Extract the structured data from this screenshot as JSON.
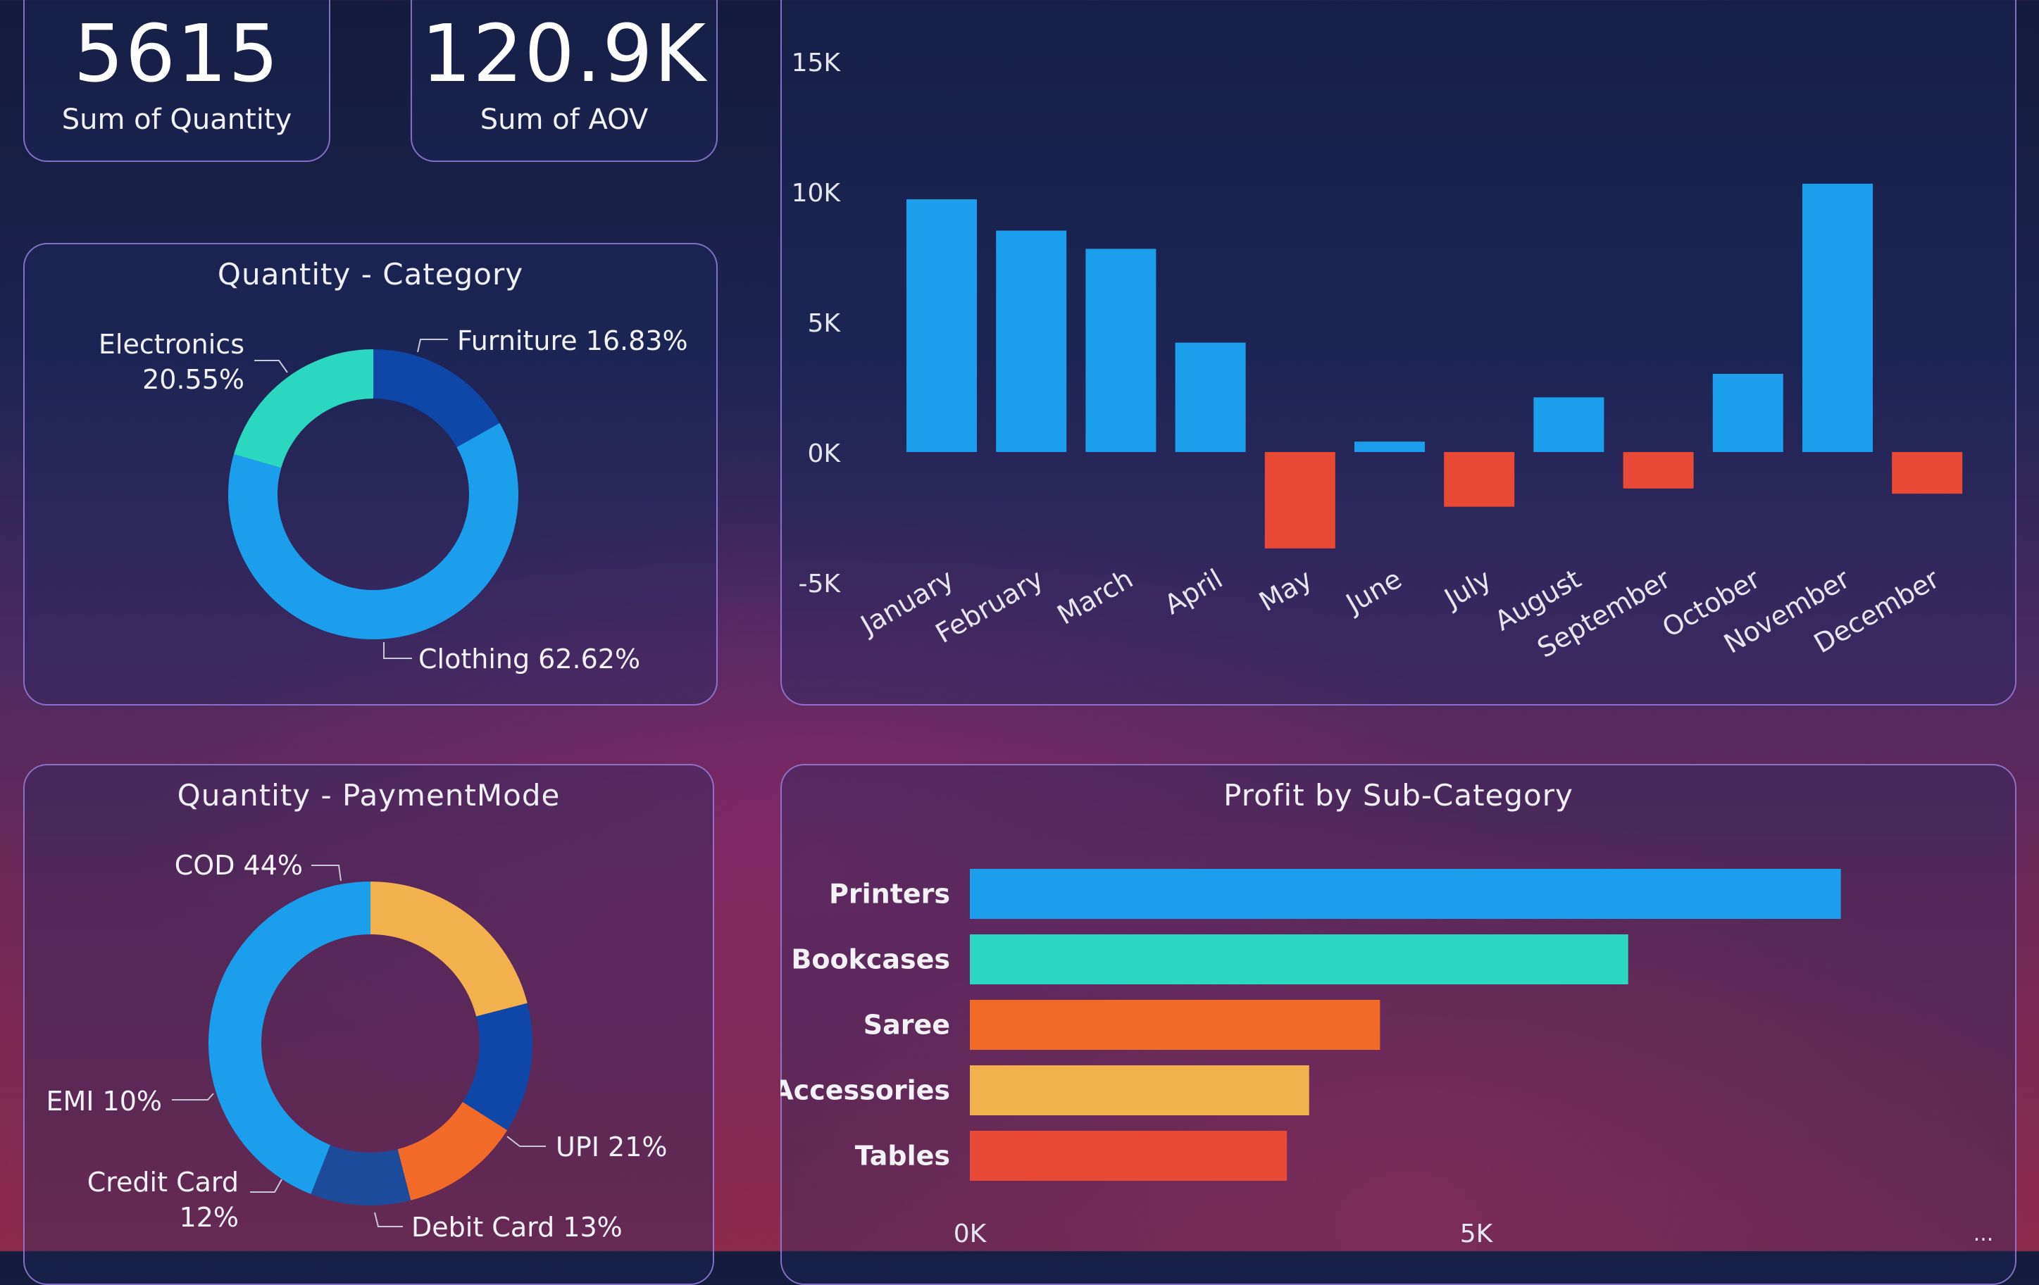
{
  "kpis": [
    {
      "value": "5615",
      "label": "Sum of Quantity"
    },
    {
      "value": "120.9K",
      "label": "Sum of AOV"
    }
  ],
  "category_chart": {
    "title": "Quantity - Category"
  },
  "payment_chart": {
    "title": "Quantity - PaymentMode"
  },
  "subcategory_chart": {
    "title": "Profit by Sub-Category",
    "overflow_label": "..."
  },
  "colors": {
    "blue": "#1b9fec",
    "dark_blue": "#0e47a7",
    "teal": "#2bd8bf",
    "orange": "#f26a27",
    "yellow": "#f2b14c",
    "red": "#e84a35",
    "steel_blue": "#1d4b9c"
  },
  "chart_data": [
    {
      "type": "bar",
      "categories": [
        "January",
        "February",
        "March",
        "April",
        "May",
        "June",
        "July",
        "August",
        "September",
        "October",
        "November",
        "December"
      ],
      "values": [
        9700,
        8500,
        7800,
        4200,
        -3700,
        400,
        -2100,
        2100,
        -1400,
        3000,
        10300,
        -1600
      ],
      "ylim": [
        -5000,
        15000
      ],
      "yticks": [
        "15K",
        "10K",
        "5K",
        "0K",
        "-5K"
      ],
      "colors": {
        "positive": "#1b9fec",
        "negative": "#e84a35"
      }
    },
    {
      "type": "pie",
      "title": "Quantity - Category",
      "slices": [
        {
          "label": "Furniture 16.83%",
          "value": 16.83,
          "color": "#0e47a7"
        },
        {
          "label": "Clothing 62.62%",
          "value": 62.62,
          "color": "#1b9fec"
        },
        {
          "label": "Electronics 20.55%",
          "lines": [
            "Electronics",
            "20.55%"
          ],
          "value": 20.55,
          "color": "#2bd8bf"
        }
      ]
    },
    {
      "type": "pie",
      "title": "Quantity - PaymentMode",
      "slices": [
        {
          "label": "UPI 21%",
          "value": 21,
          "color": "#f2b14c"
        },
        {
          "label": "Debit Card 13%",
          "value": 13,
          "color": "#0e47a7"
        },
        {
          "label": "Credit Card 12%",
          "lines": [
            "Credit Card",
            "12%"
          ],
          "value": 12,
          "color": "#f26a27"
        },
        {
          "label": "EMI 10%",
          "value": 10,
          "color": "#1d4b9c"
        },
        {
          "label": "COD 44%",
          "value": 44,
          "color": "#1b9fec"
        }
      ]
    },
    {
      "type": "bar",
      "orientation": "horizontal",
      "title": "Profit by Sub-Category",
      "categories": [
        "Printers",
        "Bookcases",
        "Saree",
        "Accessories",
        "Tables"
      ],
      "values": [
        8600,
        6500,
        4050,
        3350,
        3130
      ],
      "colors": [
        "#1b9fec",
        "#2bd8bf",
        "#f26a27",
        "#f2b14c",
        "#e84a35"
      ],
      "xticks": [
        "0K",
        "5K"
      ],
      "xtick_values": [
        0,
        5000
      ]
    }
  ]
}
